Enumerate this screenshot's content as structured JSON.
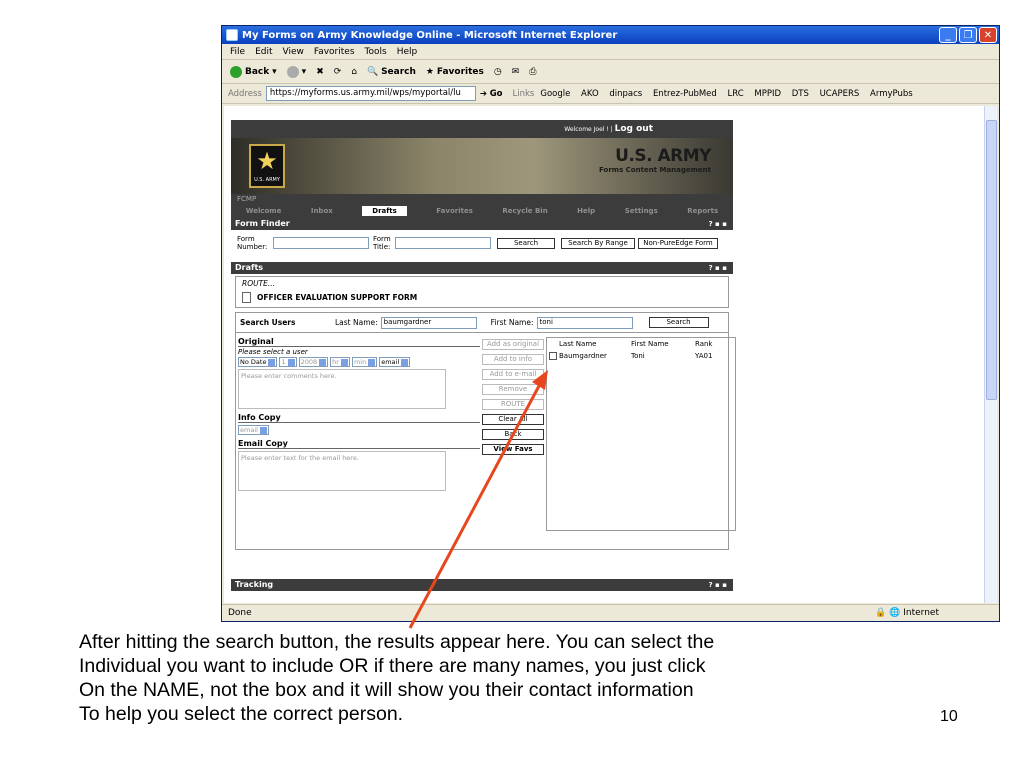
{
  "window": {
    "title": "My Forms on Army Knowledge Online - Microsoft Internet Explorer"
  },
  "menu": [
    "File",
    "Edit",
    "View",
    "Favorites",
    "Tools",
    "Help"
  ],
  "toolbar": {
    "back": "Back",
    "search": "Search",
    "favorites": "Favorites"
  },
  "address": {
    "label": "Address",
    "url": "https://myforms.us.army.mil/wps/myportal/lu",
    "go": "Go",
    "links_label": "Links",
    "links": [
      "Google",
      "AKO",
      "dinpacs",
      "Entrez-PubMed",
      "LRC",
      "MPPID",
      "DTS",
      "UCAPERS",
      "ArmyPubs"
    ]
  },
  "app": {
    "welcome": "Welcome Joel !  |",
    "logout": "Log out",
    "logo": "U.S. ARMY",
    "brand": "U.S. ARMY",
    "brand_sub": "Forms Content Management",
    "fcmp": "FCMP",
    "tabs": [
      "Welcome",
      "Inbox",
      "Drafts",
      "Favorites",
      "Recycle Bin",
      "Help",
      "Settings",
      "Reports"
    ],
    "form_finder": {
      "title": "Form Finder",
      "num_label": "Form Number:",
      "title_label": "Form Title:",
      "search": "Search",
      "range": "Search By Range",
      "nonpure": "Non-PureEdge Form"
    },
    "drafts": {
      "title": "Drafts",
      "route": "ROUTE...",
      "form": "OFFICER EVALUATION SUPPORT FORM"
    },
    "search_users": {
      "label": "Search Users",
      "last_label": "Last Name:",
      "last_value": "baumgardner",
      "first_label": "First Name:",
      "first_value": "toni",
      "button": "Search"
    },
    "original": {
      "label": "Original",
      "hint": "Please select a user",
      "date": "No Date",
      "day": "1",
      "year": "2008",
      "hr": "hr",
      "min": "min",
      "method": "email",
      "comments": "Please enter comments here."
    },
    "info_copy": {
      "label": "Info Copy",
      "method": "email"
    },
    "email_copy": {
      "label": "Email Copy",
      "placeholder": "Please enter text for the email here."
    },
    "actions": [
      "Add as original",
      "Add to info",
      "Add to e-mail",
      "Remove",
      "ROUTE",
      "Clear All",
      "Back",
      "View Favs"
    ],
    "results": {
      "headers": [
        "Last Name",
        "First Name",
        "Rank"
      ],
      "rows": [
        {
          "last": "Baumgardner",
          "first": "Toni",
          "rank": "YA01"
        }
      ]
    },
    "tracking": "Tracking"
  },
  "status": {
    "done": "Done",
    "zone": "Internet"
  },
  "caption": [
    "After hitting the search button, the results appear here. You can select the",
    "Individual you want to include OR if there are many names, you just click",
    "On the NAME, not the box and it will show you their contact information",
    "To help you select the correct person."
  ],
  "page_number": "10"
}
